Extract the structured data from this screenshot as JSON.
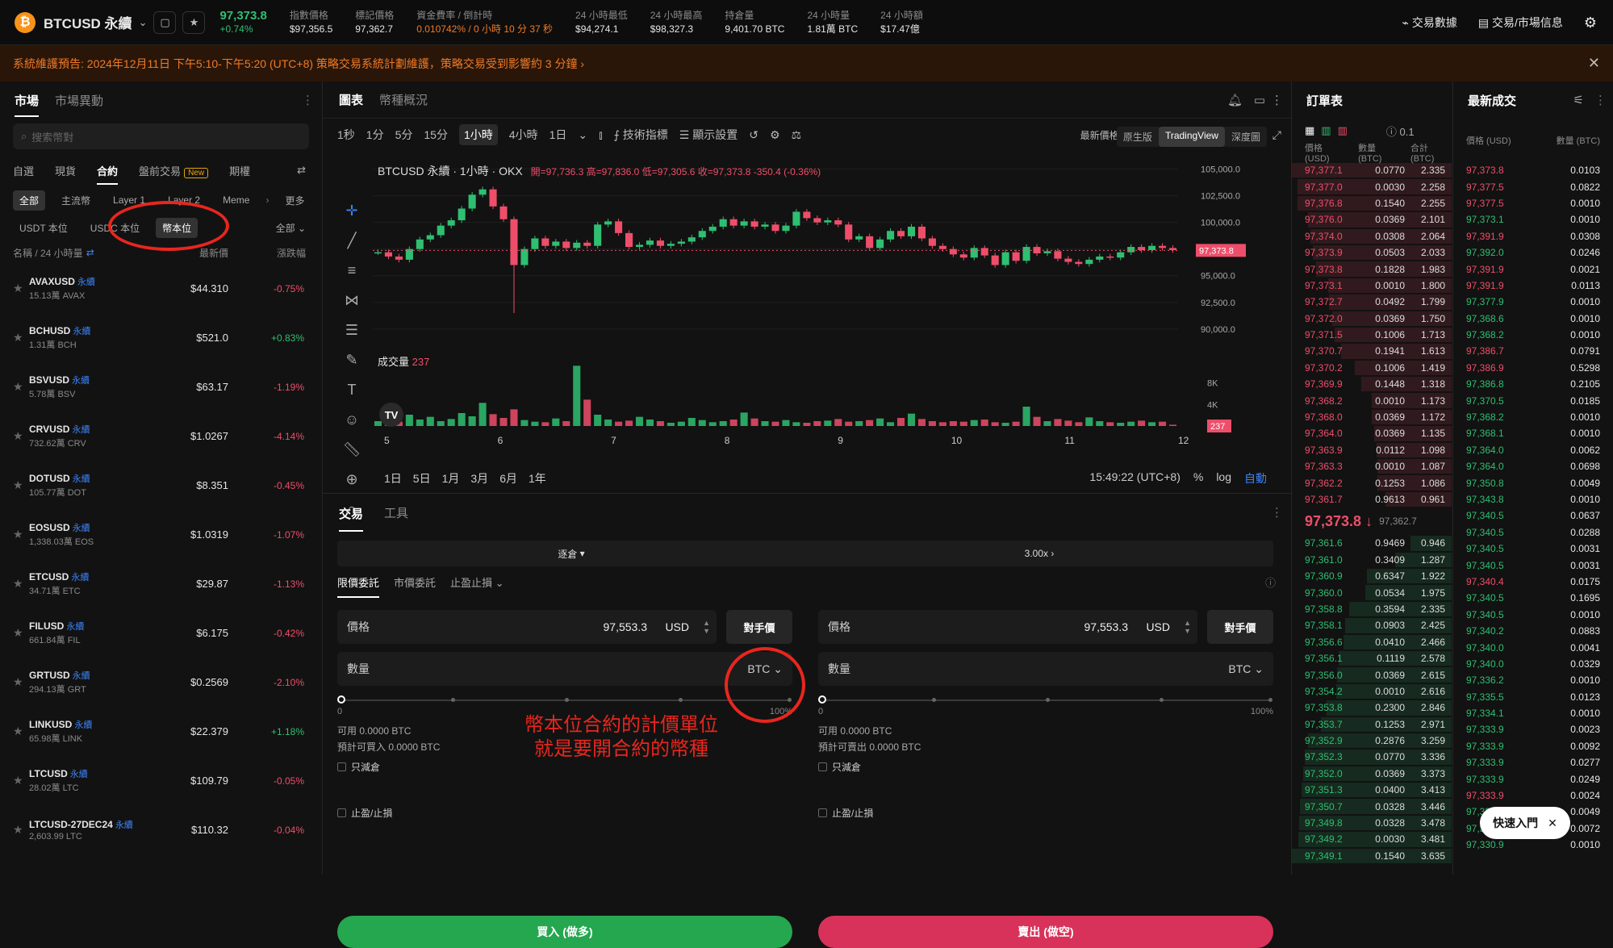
{
  "header": {
    "symbol": "BTCUSD 永續",
    "last_price": "97,373.8",
    "change": "+0.74%",
    "stats": [
      {
        "label": "指數價格",
        "value": "$97,356.5"
      },
      {
        "label": "標記價格",
        "value": "97,362.7"
      },
      {
        "label": "資金費率 / 倒計時",
        "value": "0.010742% / 0 小時 10 分 37 秒"
      },
      {
        "label": "24 小時最低",
        "value": "$94,274.1"
      },
      {
        "label": "24 小時最高",
        "value": "$98,327.3"
      },
      {
        "label": "持倉量",
        "value": "9,401.70 BTC"
      },
      {
        "label": "24 小時量",
        "value": "1.81萬 BTC"
      },
      {
        "label": "24 小時額",
        "value": "$17.47億"
      }
    ],
    "right_links": [
      "交易數據",
      "交易/市場信息"
    ]
  },
  "banner": "系統維護預告: 2024年12月11日 下午5:10-下午5:20 (UTC+8) 策略交易系統計劃維護，策略交易受到影響約 3 分鐘 ›",
  "markets": {
    "tabs": [
      "市場",
      "市場異動"
    ],
    "search_placeholder": "搜索幣對",
    "subtabs": [
      "自選",
      "現貨",
      "合約",
      "盤前交易",
      "期權"
    ],
    "new_badge": "New",
    "chips": [
      "全部",
      "主流幣",
      "Layer 1",
      "Layer 2",
      "Meme",
      "更多"
    ],
    "margin_tabs": [
      "USDT 本位",
      "USDC 本位",
      "幣本位"
    ],
    "all_label": "全部",
    "col_name": "名稱 / 24 小時量",
    "col_price": "最新價",
    "col_change": "漲跌幅",
    "perp_tag": "永續",
    "rows": [
      {
        "name": "AVAXUSD",
        "vol": "15.13萬 AVAX",
        "price": "$44.310",
        "change": "-0.75%",
        "up": false
      },
      {
        "name": "BCHUSD",
        "vol": "1.31萬 BCH",
        "price": "$521.0",
        "change": "+0.83%",
        "up": true
      },
      {
        "name": "BSVUSD",
        "vol": "5.78萬 BSV",
        "price": "$63.17",
        "change": "-1.19%",
        "up": false
      },
      {
        "name": "CRVUSD",
        "vol": "732.62萬 CRV",
        "price": "$1.0267",
        "change": "-4.14%",
        "up": false
      },
      {
        "name": "DOTUSD",
        "vol": "105.77萬 DOT",
        "price": "$8.351",
        "change": "-0.45%",
        "up": false
      },
      {
        "name": "EOSUSD",
        "vol": "1,338.03萬 EOS",
        "price": "$1.0319",
        "change": "-1.07%",
        "up": false
      },
      {
        "name": "ETCUSD",
        "vol": "34.71萬 ETC",
        "price": "$29.87",
        "change": "-1.13%",
        "up": false
      },
      {
        "name": "FILUSD",
        "vol": "661.84萬 FIL",
        "price": "$6.175",
        "change": "-0.42%",
        "up": false
      },
      {
        "name": "GRTUSD",
        "vol": "294.13萬 GRT",
        "price": "$0.2569",
        "change": "-2.10%",
        "up": false
      },
      {
        "name": "LINKUSD",
        "vol": "65.98萬 LINK",
        "price": "$22.379",
        "change": "+1.18%",
        "up": true
      },
      {
        "name": "LTCUSD",
        "vol": "28.02萬 LTC",
        "price": "$109.79",
        "change": "-0.05%",
        "up": false
      },
      {
        "name": "LTCUSD-27DEC24",
        "vol": "2,603.99 LTC",
        "price": "$110.32",
        "change": "-0.04%",
        "up": false
      }
    ]
  },
  "chart": {
    "tabs": [
      "圖表",
      "幣種概況"
    ],
    "intervals": [
      "1秒",
      "1分",
      "5分",
      "15分",
      "1小時",
      "4小時",
      "1日"
    ],
    "active_interval": "1小時",
    "tools": [
      "技術指標",
      "顯示設置"
    ],
    "price_mode": "最新價格",
    "views": [
      "原生版",
      "TradingView",
      "深度圖"
    ],
    "title": "BTCUSD 永續 · 1小時 · OKX",
    "ohlc": "開=97,736.3 高=97,836.0 低=97,305.6 收=97,373.8 -350.4 (-0.36%)",
    "volume_label": "成交量",
    "volume_value": "237",
    "ranges": [
      "1日",
      "5日",
      "1月",
      "3月",
      "6月",
      "1年"
    ],
    "clock": "15:49:22 (UTC+8)",
    "scale_opts": [
      "%",
      "log",
      "自動"
    ]
  },
  "chart_data": {
    "type": "line",
    "title": "BTCUSD 永續 · 1小時 · OKX",
    "x_ticks": [
      "5",
      "6",
      "7",
      "8",
      "9",
      "10",
      "11",
      "12"
    ],
    "y_ticks": [
      90000,
      92500,
      95000,
      97500,
      100000,
      102500,
      105000
    ],
    "ylim": [
      89000,
      105500
    ],
    "last_price": "97,373.8",
    "price_points": [
      97200,
      96800,
      96500,
      97500,
      98400,
      98800,
      99700,
      100200,
      101300,
      102600,
      103100,
      101500,
      100300,
      96000,
      97500,
      98500,
      97800,
      98200,
      97600,
      98100,
      97800,
      99800,
      100100,
      99000,
      97700,
      97900,
      98300,
      97800,
      98000,
      98200,
      98600,
      99200,
      99600,
      100300,
      99700,
      100100,
      99600,
      99800,
      99200,
      99700,
      101000,
      100400,
      100000,
      100200,
      99800,
      98400,
      98700,
      97600,
      98400,
      99200,
      98700,
      99600,
      98500,
      97800,
      97500,
      97000,
      96700,
      97600,
      96900,
      96000,
      97200,
      96400,
      97700,
      97100,
      97300,
      96600,
      96300,
      96100,
      96500,
      96800,
      96700,
      97200,
      97700,
      97400,
      97800,
      97600,
      97400
    ],
    "volume_y_ticks": [
      "4K",
      "8K"
    ],
    "volume_last": "237",
    "volume_points": [
      900,
      1400,
      800,
      2100,
      1200,
      1700,
      900,
      1300,
      2400,
      1800,
      4300,
      2200,
      1500,
      3100,
      1100,
      800,
      700,
      1400,
      900,
      11200,
      4900,
      2100,
      1200,
      800,
      1000,
      1700,
      1200,
      900,
      600,
      800,
      1500,
      1100,
      700,
      900,
      1200,
      2500,
      1400,
      900,
      800,
      1100,
      700,
      600,
      900,
      1000,
      1300,
      800,
      900,
      1100,
      1400,
      700,
      1500,
      2300,
      1300,
      900,
      700,
      900,
      800,
      1100,
      1200,
      700,
      600,
      800,
      3600,
      1700,
      900,
      1300,
      1000,
      700,
      1600,
      900,
      700,
      600,
      800,
      1000,
      700,
      800,
      237
    ]
  },
  "trade": {
    "tabs": [
      "交易",
      "工具"
    ],
    "margin_mode": "逐倉",
    "leverage": "3.00x",
    "order_types": [
      "限價委託",
      "市價委託",
      "止盈止損"
    ],
    "price_label": "價格",
    "price_value": "97,553.3",
    "price_unit": "USD",
    "counter_btn": "對手價",
    "qty_label": "數量",
    "qty_unit": "BTC",
    "slider_min": "0",
    "slider_max": "100%",
    "buy": {
      "avail": "可用 0.0000 BTC",
      "est": "預計可買入 0.0000 BTC",
      "btn": "買入 (做多)"
    },
    "sell": {
      "avail": "可用 0.0000 BTC",
      "est": "預計可賣出 0.0000 BTC",
      "btn": "賣出 (做空)"
    },
    "reduce_only": "只減倉",
    "tpsl": "止盈/止損",
    "annotation": [
      "幣本位合約的計價單位",
      "就是要開合約的幣種"
    ]
  },
  "orderbook": {
    "title": "訂單表",
    "step": "0.1",
    "cols": [
      "價格 (USD)",
      "數量 (BTC)",
      "合計 (BTC)"
    ],
    "asks": [
      [
        "97,377.1",
        "0.0770",
        "2.335"
      ],
      [
        "97,377.0",
        "0.0030",
        "2.258"
      ],
      [
        "97,376.8",
        "0.1540",
        "2.255"
      ],
      [
        "97,376.0",
        "0.0369",
        "2.101"
      ],
      [
        "97,374.0",
        "0.0308",
        "2.064"
      ],
      [
        "97,373.9",
        "0.0503",
        "2.033"
      ],
      [
        "97,373.8",
        "0.1828",
        "1.983"
      ],
      [
        "97,373.1",
        "0.0010",
        "1.800"
      ],
      [
        "97,372.7",
        "0.0492",
        "1.799"
      ],
      [
        "97,372.0",
        "0.0369",
        "1.750"
      ],
      [
        "97,371.5",
        "0.1006",
        "1.713"
      ],
      [
        "97,370.7",
        "0.1941",
        "1.613"
      ],
      [
        "97,370.2",
        "0.1006",
        "1.419"
      ],
      [
        "97,369.9",
        "0.1448",
        "1.318"
      ],
      [
        "97,368.2",
        "0.0010",
        "1.173"
      ],
      [
        "97,368.0",
        "0.0369",
        "1.172"
      ],
      [
        "97,364.0",
        "0.0369",
        "1.135"
      ],
      [
        "97,363.9",
        "0.0112",
        "1.098"
      ],
      [
        "97,363.3",
        "0.0010",
        "1.087"
      ],
      [
        "97,362.2",
        "0.1253",
        "1.086"
      ],
      [
        "97,361.7",
        "0.9613",
        "0.961"
      ]
    ],
    "mid_price": "97,373.8 ↓",
    "mark_price": "97,362.7",
    "bids": [
      [
        "97,361.6",
        "0.9469",
        "0.946"
      ],
      [
        "97,361.0",
        "0.3409",
        "1.287"
      ],
      [
        "97,360.9",
        "0.6347",
        "1.922"
      ],
      [
        "97,360.0",
        "0.0534",
        "1.975"
      ],
      [
        "97,358.8",
        "0.3594",
        "2.335"
      ],
      [
        "97,358.1",
        "0.0903",
        "2.425"
      ],
      [
        "97,356.6",
        "0.0410",
        "2.466"
      ],
      [
        "97,356.1",
        "0.1119",
        "2.578"
      ],
      [
        "97,356.0",
        "0.0369",
        "2.615"
      ],
      [
        "97,354.2",
        "0.0010",
        "2.616"
      ],
      [
        "97,353.8",
        "0.2300",
        "2.846"
      ],
      [
        "97,353.7",
        "0.1253",
        "2.971"
      ],
      [
        "97,352.9",
        "0.2876",
        "3.259"
      ],
      [
        "97,352.3",
        "0.0770",
        "3.336"
      ],
      [
        "97,352.0",
        "0.0369",
        "3.373"
      ],
      [
        "97,351.3",
        "0.0400",
        "3.413"
      ],
      [
        "97,350.7",
        "0.0328",
        "3.446"
      ],
      [
        "97,349.8",
        "0.0328",
        "3.478"
      ],
      [
        "97,349.2",
        "0.0030",
        "3.481"
      ],
      [
        "97,349.1",
        "0.1540",
        "3.635"
      ]
    ]
  },
  "trades": {
    "title": "最新成交",
    "cols": [
      "價格 (USD)",
      "數量 (BTC)"
    ],
    "rows": [
      [
        "97,373.8",
        "0.0103",
        false
      ],
      [
        "97,377.5",
        "0.0822",
        false
      ],
      [
        "97,377.5",
        "0.0010",
        false
      ],
      [
        "97,373.1",
        "0.0010",
        true
      ],
      [
        "97,391.9",
        "0.0308",
        false
      ],
      [
        "97,392.0",
        "0.0246",
        true
      ],
      [
        "97,391.9",
        "0.0021",
        false
      ],
      [
        "97,391.9",
        "0.0113",
        false
      ],
      [
        "97,377.9",
        "0.0010",
        true
      ],
      [
        "97,368.6",
        "0.0010",
        true
      ],
      [
        "97,368.2",
        "0.0010",
        true
      ],
      [
        "97,386.7",
        "0.0791",
        false
      ],
      [
        "97,386.9",
        "0.5298",
        false
      ],
      [
        "97,386.8",
        "0.2105",
        true
      ],
      [
        "97,370.5",
        "0.0185",
        true
      ],
      [
        "97,368.2",
        "0.0010",
        true
      ],
      [
        "97,368.1",
        "0.0010",
        true
      ],
      [
        "97,364.0",
        "0.0062",
        true
      ],
      [
        "97,364.0",
        "0.0698",
        true
      ],
      [
        "97,350.8",
        "0.0049",
        true
      ],
      [
        "97,343.8",
        "0.0010",
        true
      ],
      [
        "97,340.5",
        "0.0637",
        true
      ],
      [
        "97,340.5",
        "0.0288",
        true
      ],
      [
        "97,340.5",
        "0.0031",
        true
      ],
      [
        "97,340.5",
        "0.0031",
        true
      ],
      [
        "97,340.4",
        "0.0175",
        false
      ],
      [
        "97,340.5",
        "0.1695",
        true
      ],
      [
        "97,340.5",
        "0.0010",
        true
      ],
      [
        "97,340.2",
        "0.0883",
        true
      ],
      [
        "97,340.0",
        "0.0041",
        true
      ],
      [
        "97,340.0",
        "0.0329",
        true
      ],
      [
        "97,336.2",
        "0.0010",
        true
      ],
      [
        "97,335.5",
        "0.0123",
        true
      ],
      [
        "97,334.1",
        "0.0010",
        true
      ],
      [
        "97,333.9",
        "0.0023",
        true
      ],
      [
        "97,333.9",
        "0.0092",
        true
      ],
      [
        "97,333.9",
        "0.0277",
        true
      ],
      [
        "97,333.9",
        "0.0249",
        true
      ],
      [
        "97,333.9",
        "0.0024",
        false
      ],
      [
        "97,333.9",
        "0.0049",
        true
      ],
      [
        "97,331.2",
        "0.0072",
        true
      ],
      [
        "97,330.9",
        "0.0010",
        true
      ]
    ],
    "quick_start": "快速入門"
  }
}
